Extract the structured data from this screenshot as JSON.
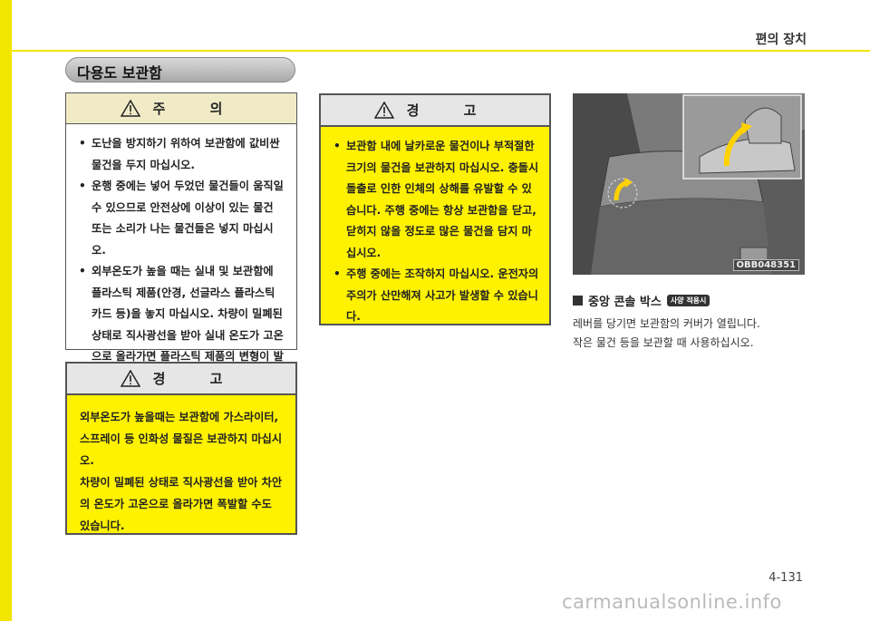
{
  "header": {
    "title": "편의 장치"
  },
  "section_title": "다용도 보관함",
  "caution": {
    "title": "주 의",
    "items": [
      "도난을 방지하기 위하여 보관함에 값비싼 물건을 두지 마십시오.",
      "운행 중에는 넣어 두었던 물건들이 움직일 수 있으므로 안전상에 이상이 있는 물건 또는 소리가 나는 물건들은 넣지 마십시오.",
      "외부온도가 높을 때는 실내 및 보관함에 플라스틱 제품(안경, 선글라스 플라스틱 카드 등)을 놓지 마십시오. 차량이 밀폐된 상태로 직사광선을 받아 실내 온도가 고온으로 올라가면 플라스틱 제품의 변형이 발생할 수 있습니다."
    ]
  },
  "warning_left": {
    "title": "경 고",
    "para1": "외부온도가 높을때는 보관함에 가스라이터, 스프레이 등 인화성 물질은 보관하지 마십시오.",
    "para2": "차량이 밀폐된 상태로 직사광선을 받아 차안의 온도가 고온으로 올라가면 폭발할 수도 있습니다."
  },
  "warning_mid": {
    "title": "경 고",
    "items": [
      "보관함 내에 날카로운 물건이나 부적절한 크기의 물건을 보관하지 마십시오. 충돌시 돌출로 인한 인체의 상해를 유발할 수 있습니다. 주행 중에는 항상 보관함을 닫고, 닫히지 않을 정도로 많은 물건을 담지 마십시오.",
      "주행 중에는 조작하지 마십시오. 운전자의 주의가 산만해져 사고가 발생할 수 있습니다."
    ]
  },
  "photo": {
    "code": "OBB048351"
  },
  "caption": {
    "label": "중앙 콘솔 박스",
    "badge": "사양 적용시"
  },
  "description": {
    "line1": "레버를 당기면 보관함의 커버가 열립니다.",
    "line2": "작은 물건 등을 보관할 때 사용하십시오."
  },
  "page_number": "4-131",
  "watermark": "carmanualsonline.info"
}
